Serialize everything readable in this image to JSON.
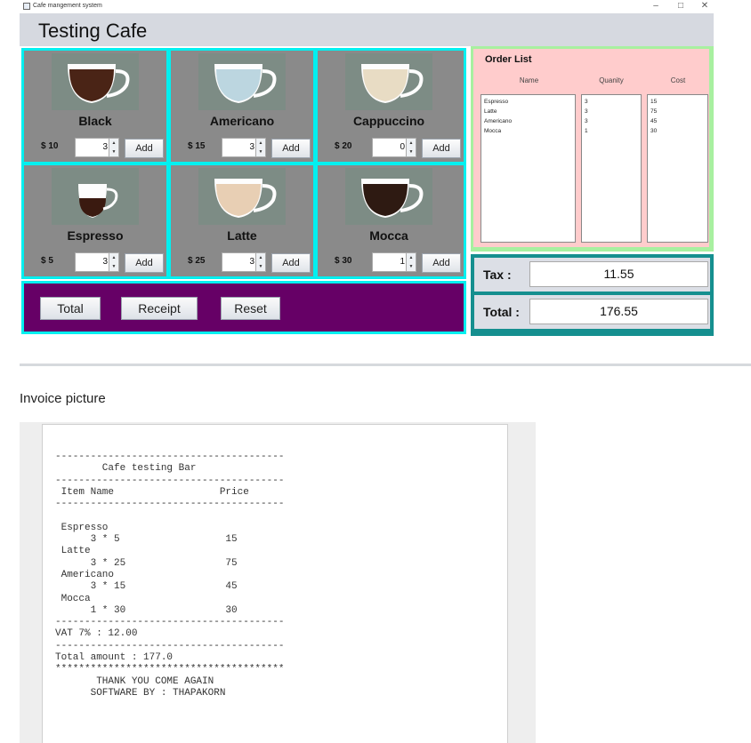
{
  "window": {
    "title": "Cafe mangement system",
    "controls": {
      "minimize": "–",
      "maximize": "□",
      "close": "✕"
    },
    "icons": {
      "app": "coffee-app-icon"
    }
  },
  "header": {
    "title": "Testing Cafe"
  },
  "menu": [
    {
      "name": "Black",
      "price": "$ 10",
      "qty": "3",
      "add": "Add",
      "liquid": "#4a2416"
    },
    {
      "name": "Americano",
      "price": "$ 15",
      "qty": "3",
      "add": "Add",
      "liquid": "#bcd6e0"
    },
    {
      "name": "Cappuccino",
      "price": "$ 20",
      "qty": "0",
      "add": "Add",
      "liquid": "#e8dcc4"
    },
    {
      "name": "Espresso",
      "price": "$ 5",
      "qty": "3",
      "add": "Add",
      "liquid": "#3a1a10"
    },
    {
      "name": "Latte",
      "price": "$ 25",
      "qty": "3",
      "add": "Add",
      "liquid": "#e8cfb4"
    },
    {
      "name": "Mocca",
      "price": "$ 30",
      "qty": "1",
      "add": "Add",
      "liquid": "#2e1a12"
    }
  ],
  "actions": {
    "total": "Total",
    "receipt": "Receipt",
    "reset": "Reset"
  },
  "order_list": {
    "title": "Order List",
    "headers": {
      "name": "Name",
      "quantity": "Quanity",
      "cost": "Cost"
    },
    "names": "Espresso\nLatte\nAmericano\nMocca",
    "quantities": "3\n3\n3\n1",
    "costs": "15\n75\n45\n30"
  },
  "totals": {
    "tax_label": "Tax :",
    "tax_value": "11.55",
    "total_label": "Total :",
    "total_value": "176.55"
  },
  "invoice": {
    "section_title": "Invoice picture",
    "receipt_text": "---------------------------------------\n        Cafe testing Bar\n---------------------------------------\n Item Name                  Price\n---------------------------------------\n\n Espresso\n      3 * 5                  15\n Latte\n      3 * 25                 75\n Americano\n      3 * 15                 45\n Mocca\n      1 * 30                 30\n---------------------------------------\nVAT 7% : 12.00\n---------------------------------------\nTotal amount : 177.0\n***************************************\n       THANK YOU COME AGAIN\n      SOFTWARE BY : THAPAKORN"
  },
  "colors": {
    "grid_border": "#00f0f0",
    "card_bg": "#8a8a8a",
    "action_bg": "#660066",
    "order_bg": "#ffcccc",
    "order_border": "#a8f0a0",
    "totals_bg": "#158f8f"
  }
}
